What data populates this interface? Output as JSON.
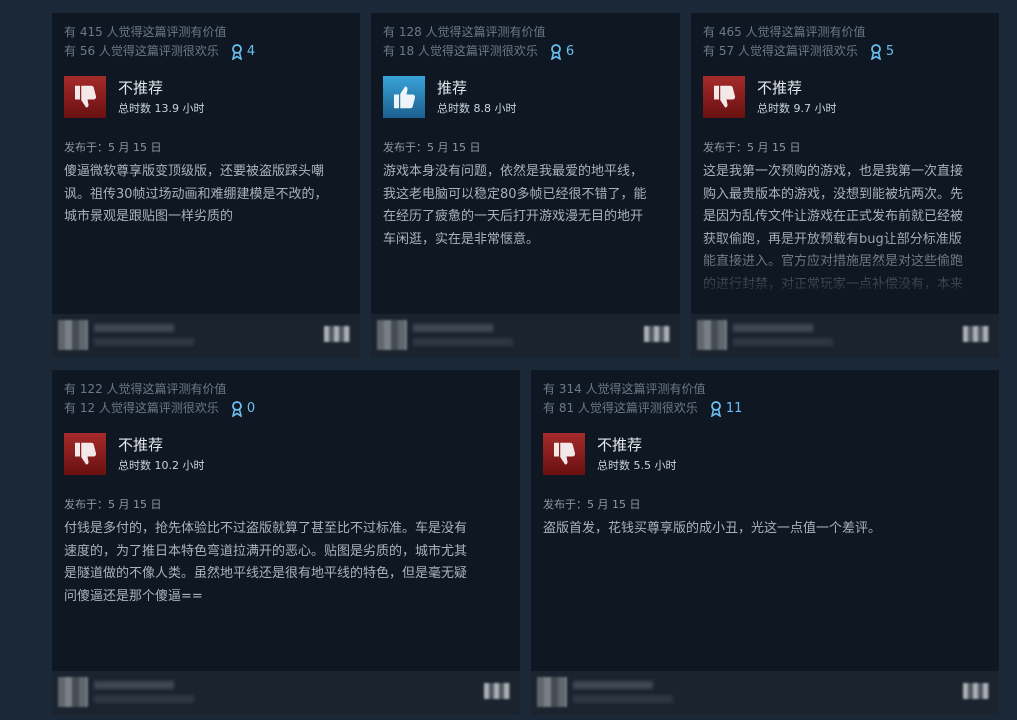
{
  "reviews": [
    {
      "helpful": "有 415 人觉得这篇评测有价值",
      "funny": "有 56 人觉得这篇评测很欢乐",
      "awards": "4",
      "verdict": "不推荐",
      "recommended": false,
      "hours": "总时数 13.9 小时",
      "posted": "发布于：5 月 15 日",
      "text": "傻逼微软尊享版变顶级版，还要被盗版踩头嘲\n讽。祖传30帧过场动画和难绷建模是不改的，\n城市景观是跟贴图一样劣质的"
    },
    {
      "helpful": "有 128 人觉得这篇评测有价值",
      "funny": "有 18 人觉得这篇评测很欢乐",
      "awards": "6",
      "verdict": "推荐",
      "recommended": true,
      "hours": "总时数 8.8 小时",
      "posted": "发布于：5 月 15 日",
      "text": "游戏本身没有问题，依然是我最爱的地平线，\n我这老电脑可以稳定80多帧已经很不错了，能\n在经历了疲惫的一天后打开游戏漫无目的地开\n车闲逛，实在是非常惬意。"
    },
    {
      "helpful": "有 465 人觉得这篇评测有价值",
      "funny": "有 57 人觉得这篇评测很欢乐",
      "awards": "5",
      "verdict": "不推荐",
      "recommended": false,
      "hours": "总时数 9.7 小时",
      "posted": "发布于：5 月 15 日",
      "text": "这是我第一次预购的游戏，也是我第一次直接\n购入最贵版本的游戏，没想到能被坑两次。先\n是因为乱传文件让游戏在正式发布前就已经被\n获取偷跑，再是开放预载有bug让部分标准版\n能直接进入。官方应对措施居然是对这些偷跑\n的进行封禁，对正常玩家一点补偿没有，本来"
    },
    {
      "helpful": "有 122 人觉得这篇评测有价值",
      "funny": "有 12 人觉得这篇评测很欢乐",
      "awards": "0",
      "verdict": "不推荐",
      "recommended": false,
      "hours": "总时数 10.2 小时",
      "posted": "发布于：5 月 15 日",
      "text": "付钱是多付的，抢先体验比不过盗版就算了甚至比不过标准。车是没有\n速度的，为了推日本特色弯道拉满开的恶心。贴图是劣质的，城市尤其\n是隧道做的不像人类。虽然地平线还是很有地平线的特色，但是毫无疑\n问傻逼还是那个傻逼=="
    },
    {
      "helpful": "有 314 人觉得这篇评测有价值",
      "funny": "有 81 人觉得这篇评测很欢乐",
      "awards": "11",
      "verdict": "不推荐",
      "recommended": false,
      "hours": "总时数 5.5 小时",
      "posted": "发布于：5 月 15 日",
      "text": "盗版首发，花钱买尊享版的成小丑，光这一点值一个差评。"
    }
  ]
}
